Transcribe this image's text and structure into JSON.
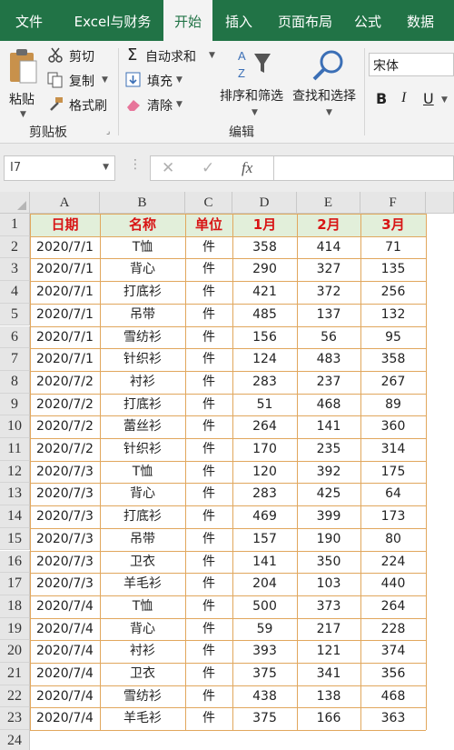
{
  "ribbon_tabs": [
    "文件",
    "Excel与财务",
    "开始",
    "插入",
    "页面布局",
    "公式",
    "数据"
  ],
  "active_tab": "开始",
  "clipboard": {
    "paste": "粘贴",
    "cut": "剪切",
    "copy": "复制",
    "format_painter": "格式刷",
    "group_label": "剪贴板"
  },
  "editing": {
    "autosum": "自动求和",
    "fill": "填充",
    "clear": "清除",
    "sort_filter": "排序和筛选",
    "find_select": "查找和选择",
    "group_label": "编辑"
  },
  "font": {
    "name": "宋体",
    "bold": "B",
    "italic": "I",
    "underline": "U"
  },
  "formula_bar": {
    "name_box": "I7",
    "fx": "fx",
    "formula": ""
  },
  "columns": [
    "A",
    "B",
    "C",
    "D",
    "E",
    "F"
  ],
  "header_row": [
    "日期",
    "名称",
    "单位",
    "1月",
    "2月",
    "3月"
  ],
  "rows": [
    [
      "2020/7/1",
      "T恤",
      "件",
      "358",
      "414",
      "71"
    ],
    [
      "2020/7/1",
      "背心",
      "件",
      "290",
      "327",
      "135"
    ],
    [
      "2020/7/1",
      "打底衫",
      "件",
      "421",
      "372",
      "256"
    ],
    [
      "2020/7/1",
      "吊带",
      "件",
      "485",
      "137",
      "132"
    ],
    [
      "2020/7/1",
      "雪纺衫",
      "件",
      "156",
      "56",
      "95"
    ],
    [
      "2020/7/1",
      "针织衫",
      "件",
      "124",
      "483",
      "358"
    ],
    [
      "2020/7/2",
      "衬衫",
      "件",
      "283",
      "237",
      "267"
    ],
    [
      "2020/7/2",
      "打底衫",
      "件",
      "51",
      "468",
      "89"
    ],
    [
      "2020/7/2",
      "蕾丝衫",
      "件",
      "264",
      "141",
      "360"
    ],
    [
      "2020/7/2",
      "针织衫",
      "件",
      "170",
      "235",
      "314"
    ],
    [
      "2020/7/3",
      "T恤",
      "件",
      "120",
      "392",
      "175"
    ],
    [
      "2020/7/3",
      "背心",
      "件",
      "283",
      "425",
      "64"
    ],
    [
      "2020/7/3",
      "打底衫",
      "件",
      "469",
      "399",
      "173"
    ],
    [
      "2020/7/3",
      "吊带",
      "件",
      "157",
      "190",
      "80"
    ],
    [
      "2020/7/3",
      "卫衣",
      "件",
      "141",
      "350",
      "224"
    ],
    [
      "2020/7/3",
      "羊毛衫",
      "件",
      "204",
      "103",
      "440"
    ],
    [
      "2020/7/4",
      "T恤",
      "件",
      "500",
      "373",
      "264"
    ],
    [
      "2020/7/4",
      "背心",
      "件",
      "59",
      "217",
      "228"
    ],
    [
      "2020/7/4",
      "衬衫",
      "件",
      "393",
      "121",
      "374"
    ],
    [
      "2020/7/4",
      "卫衣",
      "件",
      "375",
      "341",
      "356"
    ],
    [
      "2020/7/4",
      "雪纺衫",
      "件",
      "438",
      "138",
      "468"
    ],
    [
      "2020/7/4",
      "羊毛衫",
      "件",
      "375",
      "166",
      "363"
    ]
  ],
  "row_numbers": [
    "1",
    "2",
    "3",
    "4",
    "5",
    "6",
    "7",
    "8",
    "9",
    "10",
    "11",
    "12",
    "13",
    "14",
    "15",
    "16",
    "17",
    "18",
    "19",
    "20",
    "21",
    "22",
    "23",
    "24"
  ],
  "colors": {
    "ribbon_green": "#217346",
    "header_fill": "#e2efda",
    "header_text": "#d81515",
    "border_orange": "#e1a75d"
  }
}
